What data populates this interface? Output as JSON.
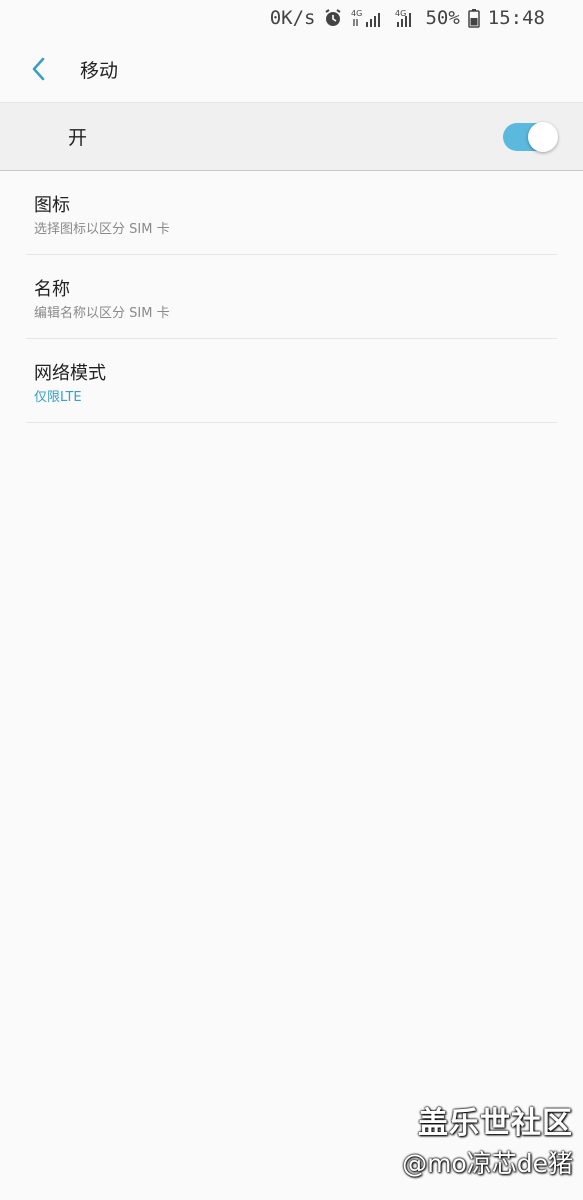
{
  "status_bar": {
    "speed": "0K/s",
    "battery": "50%",
    "time": "15:48",
    "net_label_1": "4G",
    "net_label_2": "4G"
  },
  "header": {
    "title": "移动"
  },
  "master_toggle": {
    "label": "开",
    "on": true,
    "color": "#5ab9dc"
  },
  "items": [
    {
      "title": "图标",
      "subtitle": "选择图标以区分 SIM 卡"
    },
    {
      "title": "名称",
      "subtitle": "编辑名称以区分 SIM 卡"
    },
    {
      "title": "网络模式",
      "subtitle": "仅限LTE"
    }
  ],
  "accent_color": "#3a9fc6",
  "watermark": {
    "line1": "盖乐世社区",
    "line2": "@mo凉芯de猪"
  }
}
